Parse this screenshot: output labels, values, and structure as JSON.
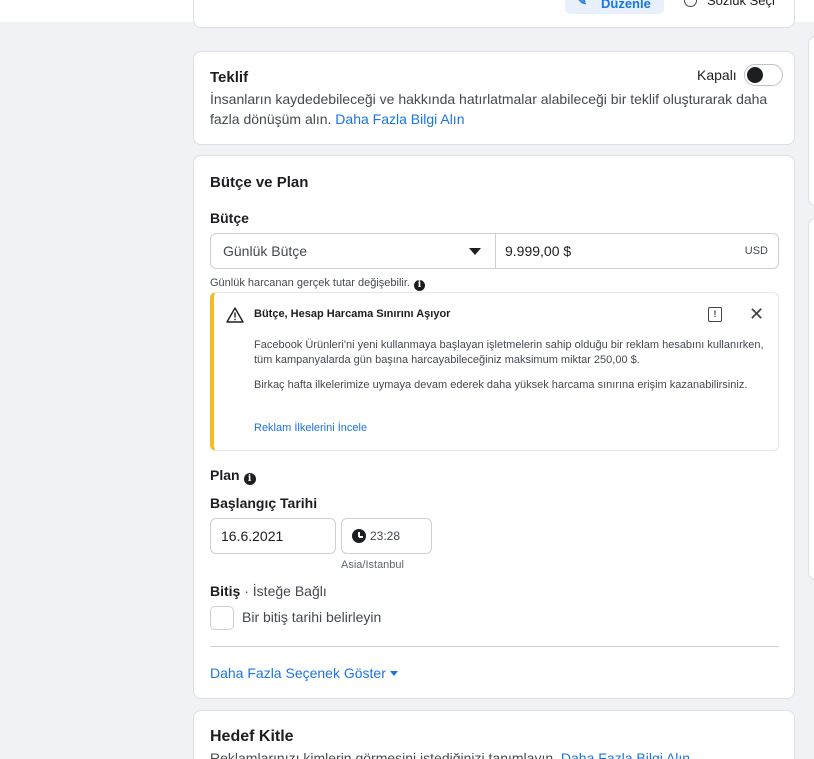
{
  "topbar": {
    "edit_label": "Düzenle",
    "right_item_label": "Sözlük Seçi"
  },
  "offer": {
    "title": "Teklif",
    "toggle_label": "Kapalı",
    "toggle_on": false,
    "description": "İnsanların kaydedebileceği ve hakkında hatırlatmalar alabileceği bir teklif oluşturarak daha fazla dönüşüm alın.",
    "learn_more": "Daha Fazla Bilgi Alın"
  },
  "budget_plan": {
    "title": "Bütçe ve Plan",
    "budget_label": "Bütçe",
    "budget_type": "Günlük Bütçe",
    "budget_amount": "9.999,00 $",
    "currency": "USD",
    "hint": "Günlük harcanan gerçek tutar değişebilir.",
    "warning": {
      "title": "Bütçe, Hesap Harcama Sınırını Aşıyor",
      "paragraph1": "Facebook Ürünleri'ni yeni kullanmaya başlayan işletmelerin sahip olduğu bir reklam hesabını kullanırken, tüm kampanyalarda gün başına harcayabileceğiniz maksimum miktar 250,00 $.",
      "paragraph2": "Birkaç hafta ilkelerimize uymaya devam ederek daha yüksek harcama sınırına erişim kazanabilirsiniz.",
      "link": "Reklam İlkelerini İncele",
      "accent_color": "#f7b928"
    },
    "plan_label": "Plan",
    "start_label": "Başlangıç Tarihi",
    "start_date": "16.6.2021",
    "start_time": "23:28",
    "timezone": "Asia/Istanbul",
    "end_label": "Bitiş",
    "end_optional": "· İsteğe Bağlı",
    "end_checkbox_label": "Bir bitiş tarihi belirleyin",
    "more_options": "Daha Fazla Seçenek Göster"
  },
  "audience": {
    "title": "Hedef Kitle",
    "description": "Reklamlarınızı kimlerin görmesini istediğinizi tanımlayın.",
    "learn_more": "Daha Fazla Bilgi Alın"
  },
  "colors": {
    "link": "#1b74e4",
    "background": "#f0f2f5"
  }
}
